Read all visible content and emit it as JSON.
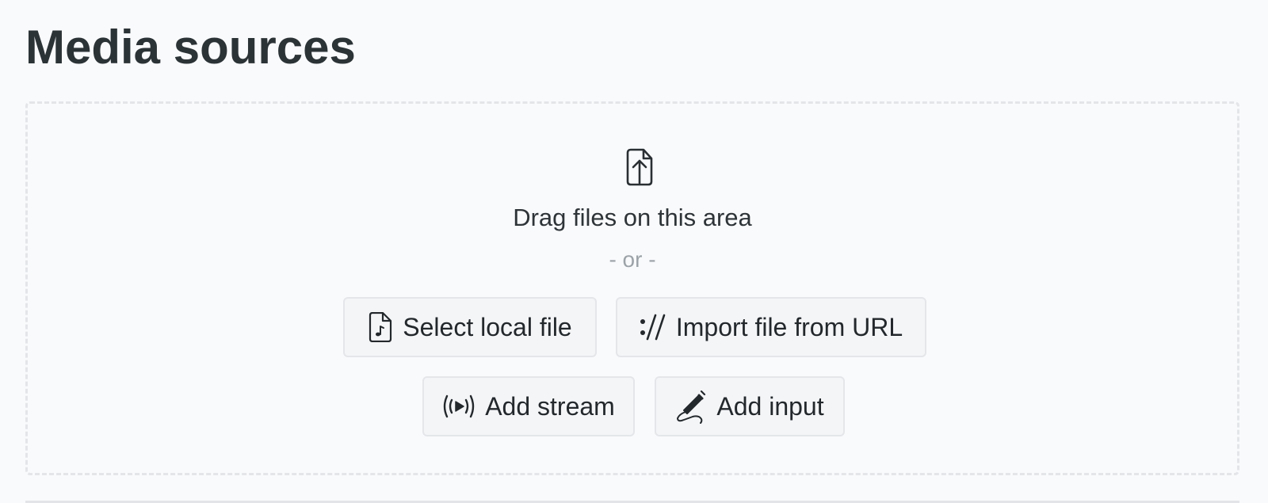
{
  "page": {
    "title": "Media sources"
  },
  "dropzone": {
    "icon": "file-upload-icon",
    "drag_text": "Drag files on this area",
    "or_text": "- or -",
    "buttons": [
      {
        "label": "Select local file",
        "icon": "audio-file-icon"
      },
      {
        "label": "Import file from URL",
        "icon": "url-icon"
      },
      {
        "label": "Add stream",
        "icon": "broadcast-icon"
      },
      {
        "label": "Add input",
        "icon": "audio-jack-icon"
      }
    ]
  },
  "colors": {
    "background": "#f9fafc",
    "title_text": "#2c3336",
    "button_bg": "#f4f5f7",
    "button_border": "#e4e6e9",
    "dropzone_border": "#e3e5e8",
    "muted_text": "#9ca3a8"
  }
}
